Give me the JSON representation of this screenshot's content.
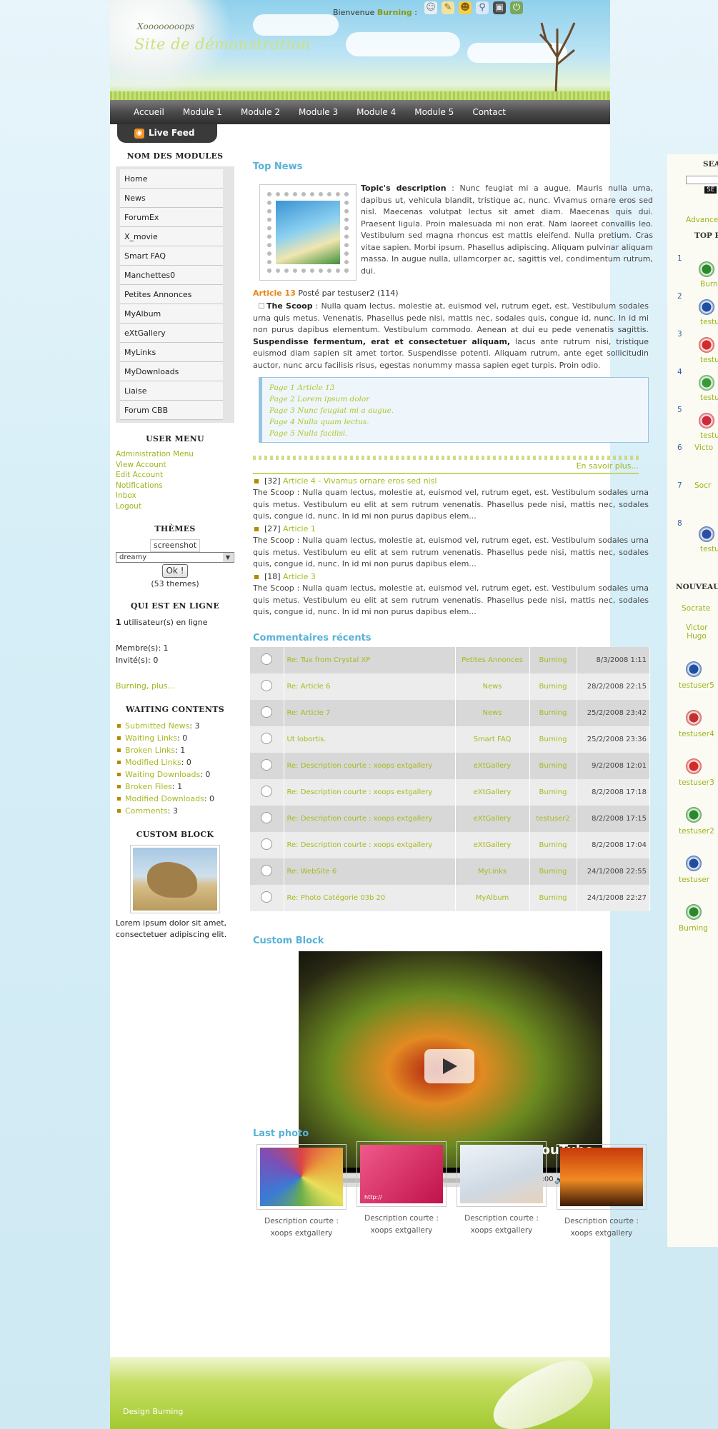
{
  "header": {
    "slogan": "Xoooooooops",
    "site_name": "Site de démonstration",
    "welcome_prefix": "Bienvenue",
    "welcome_user": "Burning",
    "welcome_sep": ":"
  },
  "nav": {
    "items": [
      "Accueil",
      "Module 1",
      "Module 2",
      "Module 3",
      "Module 4",
      "Module 5",
      "Contact"
    ],
    "live_feed": "Live Feed"
  },
  "left": {
    "modules_title": "NOM DES MODULES",
    "modules": [
      "Home",
      "News",
      "ForumEx",
      "X_movie",
      "Smart FAQ",
      "Manchettes0",
      "Petites Annonces",
      "MyAlbum",
      "eXtGallery",
      "MyLinks",
      "MyDownloads",
      "Liaise",
      "Forum CBB"
    ],
    "usermenu_title": "USER MENU",
    "usermenu": [
      "Administration Menu",
      "View Account",
      "Edit Account",
      "Notifications",
      "Inbox",
      "Logout"
    ],
    "themes_title": "THÈMES",
    "themes_screenshot": "screenshot",
    "themes_selected": "dreamy",
    "themes_ok": "Ok !",
    "themes_count": "(53 themes)",
    "online_title": "QUI EST EN LIGNE",
    "online_count": "1",
    "online_text": " utilisateur(s) en ligne",
    "members": "Membre(s): 1",
    "guests": "Invité(s): 0",
    "online_user": "Burning",
    "online_more": ", plus...",
    "waiting_title": "WAITING CONTENTS",
    "waiting": [
      {
        "label": "Submitted News",
        "value": ": 3"
      },
      {
        "label": "Waiting Links",
        "value": ": 0"
      },
      {
        "label": "Broken Links",
        "value": ": 1"
      },
      {
        "label": "Modified Links",
        "value": ": 0"
      },
      {
        "label": "Waiting Downloads",
        "value": ": 0"
      },
      {
        "label": "Broken Files",
        "value": ": 1"
      },
      {
        "label": "Modified Downloads",
        "value": ": 0"
      },
      {
        "label": "Comments",
        "value": ": 3"
      }
    ],
    "custom_title": "CUSTOM BLOCK",
    "custom_text": "Lorem ipsum dolor sit amet, consectetuer adipiscing elit."
  },
  "center": {
    "top_news_title": "Top News",
    "desc_label": "Topic's description",
    "desc_text": " : Nunc feugiat mi a augue. Mauris nulla urna, dapibus ut, vehicula blandit, tristique ac, nunc. Vivamus ornare eros sed nisl. Maecenas volutpat lectus sit amet diam. Maecenas quis dui. Praesent ligula. Proin malesuada mi non erat. Nam laoreet convallis leo. Vestibulum sed magna rhoncus est mattis eleifend. Nulla pretium. Cras vitae sapien. Morbi ipsum. Phasellus adipiscing. Aliquam pulvinar aliquam massa. In augue nulla, ullamcorper ac, sagittis vel, condimentum rutrum, dui.",
    "article_title": "Article 13",
    "article_meta": " Posté par testuser2 (114)",
    "scoop_label": "The Scoop",
    "scoop_text_1": " : Nulla quam lectus, molestie at, euismod vel, rutrum eget, est. Vestibulum sodales urna quis metus. Venenatis. Phasellus pede nisi, mattis nec, sodales quis, congue id, nunc. In id mi non purus dapibus elementum. Vestibulum commodo. Aenean at dui eu pede venenatis sagittis. ",
    "scoop_bold": "Suspendisse fermentum, erat et consectetuer aliquam,",
    "scoop_text_2": " lacus ante rutrum nisi, tristique euismod diam sapien sit amet tortor. Suspendisse potenti. Aliquam rutrum, ante eget sollicitudin auctor, nunc arcu facilisis risus, egestas nonummy massa sapien eget turpis. Proin odio.",
    "pages": [
      "Page 1 Article 13",
      "Page 2 Lorem ipsum dolor",
      "Page 3 Nunc feugiat mi a augue.",
      "Page 4 Nulla quam lectus.",
      "Page 5 Nulla facilisi."
    ],
    "more": "En savoir plus...",
    "items": [
      {
        "count": "[32]",
        "title": "Article 4 - Vivamus ornare eros sed nisl",
        "text": "The Scoop : Nulla quam lectus, molestie at, euismod vel, rutrum eget, est. Vestibulum sodales urna quis metus. Vestibulum eu elit at sem rutrum venenatis. Phasellus pede nisi, mattis nec, sodales quis, congue id, nunc. In id mi non purus dapibus elem..."
      },
      {
        "count": "[27]",
        "title": "Article 1",
        "text": "The Scoop : Nulla quam lectus, molestie at, euismod vel, rutrum eget, est. Vestibulum sodales urna quis metus. Vestibulum eu elit at sem rutrum venenatis. Phasellus pede nisi, mattis nec, sodales quis, congue id, nunc. In id mi non purus dapibus elem..."
      },
      {
        "count": "[18]",
        "title": "Article 3",
        "text": "The Scoop : Nulla quam lectus, molestie at, euismod vel, rutrum eget, est. Vestibulum sodales urna quis metus. Vestibulum eu elit at sem rutrum venenatis. Phasellus pede nisi, mattis nec, sodales quis, congue id, nunc. In id mi non purus dapibus elem..."
      }
    ],
    "comments_title": "Commentaires récents",
    "comments": [
      [
        "Re: Tux from Crystal XP",
        "Petites Annonces",
        "Burning",
        "8/3/2008 1:11"
      ],
      [
        "Re: Article 6",
        "News",
        "Burning",
        "28/2/2008 22:15"
      ],
      [
        "Re: Article 7",
        "News",
        "Burning",
        "25/2/2008 23:42"
      ],
      [
        "Ut lobortis.",
        "Smart FAQ",
        "Burning",
        "25/2/2008 23:36"
      ],
      [
        "Re: Description courte : xoops extgallery",
        "eXtGallery",
        "Burning",
        "9/2/2008 12:01"
      ],
      [
        "Re: Description courte : xoops extgallery",
        "eXtGallery",
        "Burning",
        "8/2/2008 17:18"
      ],
      [
        "Re: Description courte : xoops extgallery",
        "eXtGallery",
        "testuser2",
        "8/2/2008 17:15"
      ],
      [
        "Re: Description courte : xoops extgallery",
        "eXtGallery",
        "Burning",
        "8/2/2008 17:04"
      ],
      [
        "Re: WebSite 6",
        "MyLinks",
        "Burning",
        "24/1/2008 22:55"
      ],
      [
        "Re: Photo Catégorie 03b 20",
        "MyAlbum",
        "Burning",
        "24/1/2008 22:27"
      ]
    ],
    "custom_title": "Custom Block",
    "video_brand": "YouTube",
    "video_time": "0:00 / 0:00",
    "last_photo_title": "Last photo",
    "photos": [
      {
        "caption": "Description courte : xoops extgallery",
        "color": "#9a6a3a"
      },
      {
        "caption": "Description courte : xoops extgallery",
        "color": "#e0356e",
        "overlay": "http://"
      },
      {
        "caption": "Description courte : xoops extgallery",
        "color": "#dfe6ee"
      },
      {
        "caption": "Description courte : xoops extgallery",
        "color": "#e86a12"
      }
    ]
  },
  "right": {
    "search_title": "SEA",
    "search_button": "SE",
    "advanced": "Advance",
    "top_title": "TOP P",
    "ranks": [
      "1",
      "2",
      "3",
      "4",
      "5",
      "6",
      "7",
      "8"
    ],
    "top_users": [
      "Burni",
      "testu",
      "testu",
      "testu",
      "testu",
      "Victo",
      "Socr",
      "testu"
    ],
    "new_title": "NOUVEAU",
    "new_names_text": [
      "Socrate",
      "Victor Hugo"
    ],
    "new_users": [
      "testuser5",
      "testuser4",
      "testuser3",
      "testuser2",
      "testuser",
      "Burning"
    ]
  },
  "footer": {
    "credit": "Design Burning"
  }
}
